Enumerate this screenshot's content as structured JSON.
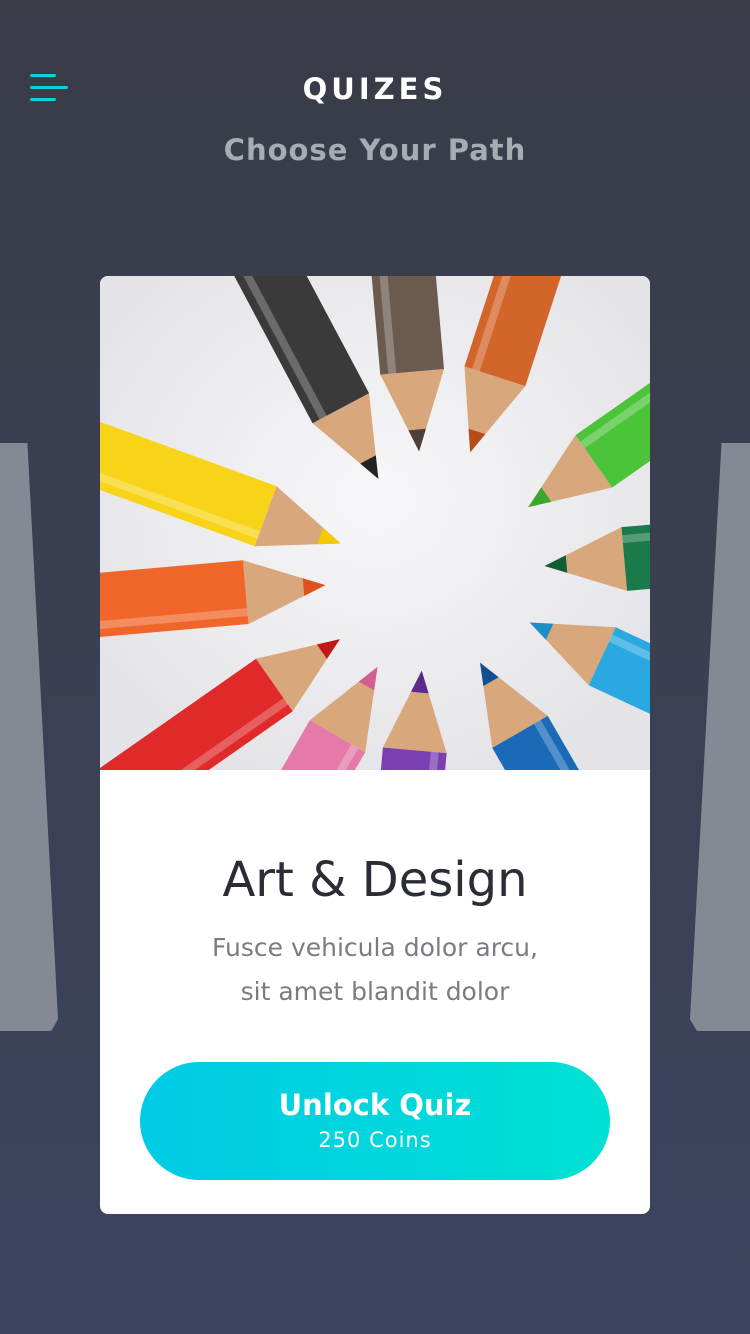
{
  "header": {
    "title": "QUIZES",
    "subtitle": "Choose Your Path",
    "menu_icon": "hamburger-menu-icon"
  },
  "colors": {
    "background": "#3b3f50",
    "accent": "#00d5dd",
    "card": "#ffffff",
    "side_card": "#858994"
  },
  "card": {
    "image": "colored-pencils-image",
    "title": "Art & Design",
    "description_line1": "Fusce vehicula dolor arcu,",
    "description_line2": "sit amet blandit dolor",
    "button_label": "Unlock Quiz",
    "button_price": "250 Coins"
  }
}
